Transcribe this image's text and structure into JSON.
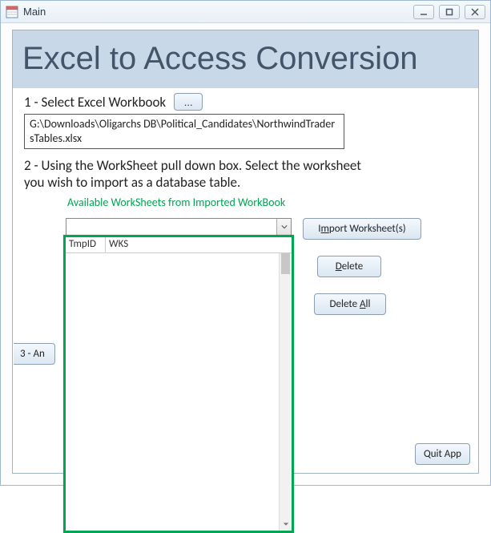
{
  "window": {
    "title": "Main"
  },
  "header": {
    "title": "Excel to Access Conversion"
  },
  "step1": {
    "label": "1 - Select Excel Workbook",
    "browse_label": "...",
    "path": "G:\\Downloads\\Oligarchs DB\\Political_Candidates\\NorthwindTradersTables.xlsx"
  },
  "step2": {
    "label": "2 - Using the WorkSheet pull down box. Select the worksheet you wish to import as a database table."
  },
  "worksheets": {
    "available_label": "Available WorkSheets from Imported WorkBook",
    "selected": "",
    "columns": {
      "c1": "TmpID",
      "c2": "WKS"
    },
    "rows": []
  },
  "buttons": {
    "import_pre": "I",
    "import_ul": "m",
    "import_post": "port Worksheet(s)",
    "delete_pre": "",
    "delete_ul": "D",
    "delete_post": "elete",
    "delete_all_pre": "Delete ",
    "delete_all_ul": "A",
    "delete_all_post": "ll",
    "analyze_pre": "3 - A",
    "analyze_ul": "n",
    "analyze_post": "",
    "quit_pre": "",
    "quit_ul": "Q",
    "quit_post": "uit App"
  }
}
